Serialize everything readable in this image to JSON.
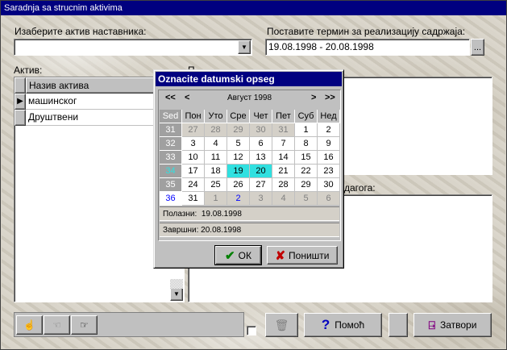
{
  "window": {
    "title": "Saradnja sa strucnim aktivima"
  },
  "form": {
    "select_label": "Изаберите актив наставника:",
    "select_value": "",
    "term_label": "Поставите термин за реализацију садржаја:",
    "term_value": "19.08.1998 - 20.08.1998",
    "term_button": "...",
    "aktiv_label": "Актив:",
    "grid": {
      "header": "Назив актива",
      "rows": [
        "машинског",
        "Друштвени"
      ]
    },
    "mid_label_fragment": "П",
    "lower_label_fragment": "дагога:"
  },
  "toolbar": {
    "help_label": "Помоћ",
    "close_label": "Затвори"
  },
  "dialog": {
    "title": "Oznacite datumski opseg",
    "nav": {
      "first": "<<",
      "prev": "<",
      "month": "Август 1998",
      "next": ">",
      "last": ">>"
    },
    "week_header": "Sed",
    "day_headers": [
      "Пон",
      "Уто",
      "Сре",
      "Чет",
      "Пет",
      "Суб",
      "Нед"
    ],
    "weeks": [
      {
        "wk": "31",
        "days": [
          [
            "27",
            "other"
          ],
          [
            "28",
            "other"
          ],
          [
            "29",
            "other"
          ],
          [
            "30",
            "other"
          ],
          [
            "31",
            "other"
          ],
          [
            "1",
            ""
          ],
          [
            "2",
            ""
          ]
        ]
      },
      {
        "wk": "32",
        "days": [
          [
            "3",
            ""
          ],
          [
            "4",
            ""
          ],
          [
            "5",
            ""
          ],
          [
            "6",
            ""
          ],
          [
            "7",
            ""
          ],
          [
            "8",
            ""
          ],
          [
            "9",
            ""
          ]
        ]
      },
      {
        "wk": "33",
        "days": [
          [
            "10",
            ""
          ],
          [
            "11",
            ""
          ],
          [
            "12",
            ""
          ],
          [
            "13",
            ""
          ],
          [
            "14",
            ""
          ],
          [
            "15",
            ""
          ],
          [
            "16",
            ""
          ]
        ]
      },
      {
        "wk": "34",
        "days": [
          [
            "17",
            ""
          ],
          [
            "18",
            ""
          ],
          [
            "19",
            "sel"
          ],
          [
            "20",
            "sel"
          ],
          [
            "21",
            ""
          ],
          [
            "22",
            ""
          ],
          [
            "23",
            ""
          ]
        ]
      },
      {
        "wk": "35",
        "days": [
          [
            "24",
            ""
          ],
          [
            "25",
            ""
          ],
          [
            "26",
            ""
          ],
          [
            "27",
            ""
          ],
          [
            "28",
            ""
          ],
          [
            "29",
            ""
          ],
          [
            "30",
            ""
          ]
        ]
      },
      {
        "wk": "36",
        "days": [
          [
            "31",
            ""
          ],
          [
            "1",
            "other"
          ],
          [
            "2",
            "other cur"
          ],
          [
            "3",
            "other"
          ],
          [
            "4",
            "other"
          ],
          [
            "5",
            "other"
          ],
          [
            "6",
            "other"
          ]
        ]
      }
    ],
    "start_label": "Полазни:",
    "start_value": "19.08.1998",
    "end_label": "Завршни:",
    "end_value": "20.08.1998",
    "ok_label": "ОК",
    "cancel_label": "Поништи"
  }
}
